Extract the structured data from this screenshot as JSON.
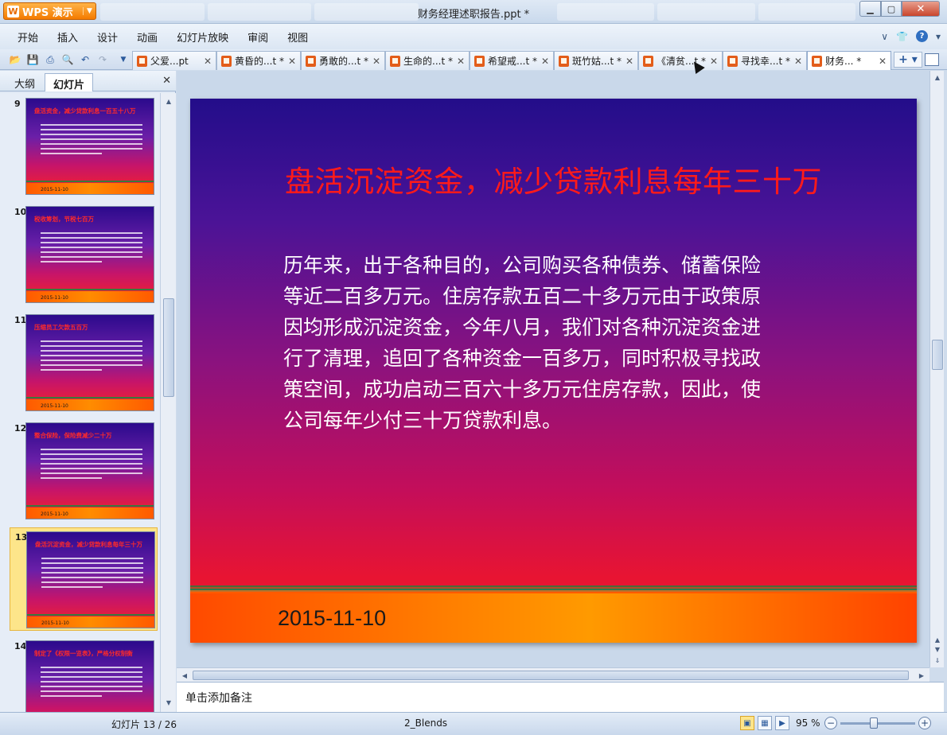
{
  "app": {
    "brand": "WPS 演示",
    "window_title": "财务经理述职报告.ppt *"
  },
  "menu": [
    "开始",
    "插入",
    "设计",
    "动画",
    "幻灯片放映",
    "审阅",
    "视图"
  ],
  "doc_tabs": [
    {
      "label": "父爱...pt",
      "active": false
    },
    {
      "label": "黄昏的...t *",
      "active": false
    },
    {
      "label": "勇敢的...t *",
      "active": false
    },
    {
      "label": "生命的...t *",
      "active": false
    },
    {
      "label": "希望戒...t *",
      "active": false
    },
    {
      "label": "斑竹姑...t *",
      "active": false
    },
    {
      "label": "《清贫...t *",
      "active": false
    },
    {
      "label": "寻找幸...t *",
      "active": false
    },
    {
      "label": "财务... *",
      "active": true
    }
  ],
  "left_panel": {
    "tab_outline": "大纲",
    "tab_slides": "幻灯片",
    "thumbnails": [
      {
        "num": "9",
        "title": "盘活资金，减少贷款利息一百五十八万",
        "date": "2015-11-10",
        "selected": false
      },
      {
        "num": "10",
        "title": "税收筹划，节税七百万",
        "date": "2015-11-10",
        "selected": false
      },
      {
        "num": "11",
        "title": "压缩员工欠款五百万",
        "date": "2015-11-10",
        "selected": false
      },
      {
        "num": "12",
        "title": "整合保险，保险费减少二十万",
        "date": "2015-11-10",
        "selected": false
      },
      {
        "num": "13",
        "title": "盘活沉淀资金，减少贷款利息每年三十万",
        "date": "2015-11-10",
        "selected": true
      },
      {
        "num": "14",
        "title": "制定了《权限一览表》，严格分权制衡",
        "date": "",
        "selected": false
      }
    ]
  },
  "slide": {
    "title": "盘活沉淀资金，减少贷款利息每年三十万",
    "body": "历年来，出于各种目的，公司购买各种债券、储蓄保险等近二百多万元。住房存款五百二十多万元由于政策原因均形成沉淀资金，今年八月，我们对各种沉淀资金进行了清理，追回了各种资金一百多万，同时积极寻找政策空间，成功启动三百六十多万元住房存款，因此，使公司每年少付三十万贷款利息。",
    "date": "2015-11-10"
  },
  "notes_placeholder": "单击添加备注",
  "status": {
    "page": "幻灯片 13 / 26",
    "theme": "2_Blends",
    "zoom": "95 %"
  },
  "colors": {
    "slide_title": "#ff1a1a",
    "accent": "#f47b00"
  }
}
